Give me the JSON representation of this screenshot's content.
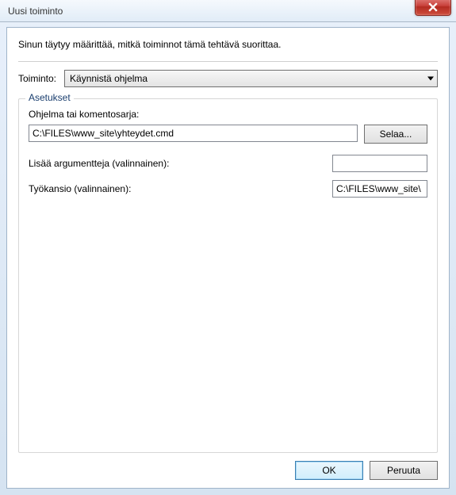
{
  "window": {
    "title": "Uusi toiminto"
  },
  "instruction": "Sinun  täytyy määrittää, mitkä toiminnot tämä tehtävä suorittaa.",
  "action": {
    "label": "Toiminto:",
    "selected": "Käynnistä ohjelma"
  },
  "settings": {
    "legend": "Asetukset",
    "program_label": "Ohjelma tai komentosarja:",
    "program_value": "C:\\FILES\\www_site\\yhteydet.cmd",
    "browse_label": "Selaa...",
    "arguments_label": "Lisää argumentteja (valinnainen):",
    "arguments_value": "",
    "startin_label": "Työkansio (valinnainen):",
    "startin_value": "C:\\FILES\\www_site\\"
  },
  "buttons": {
    "ok": "OK",
    "cancel": "Peruuta"
  }
}
